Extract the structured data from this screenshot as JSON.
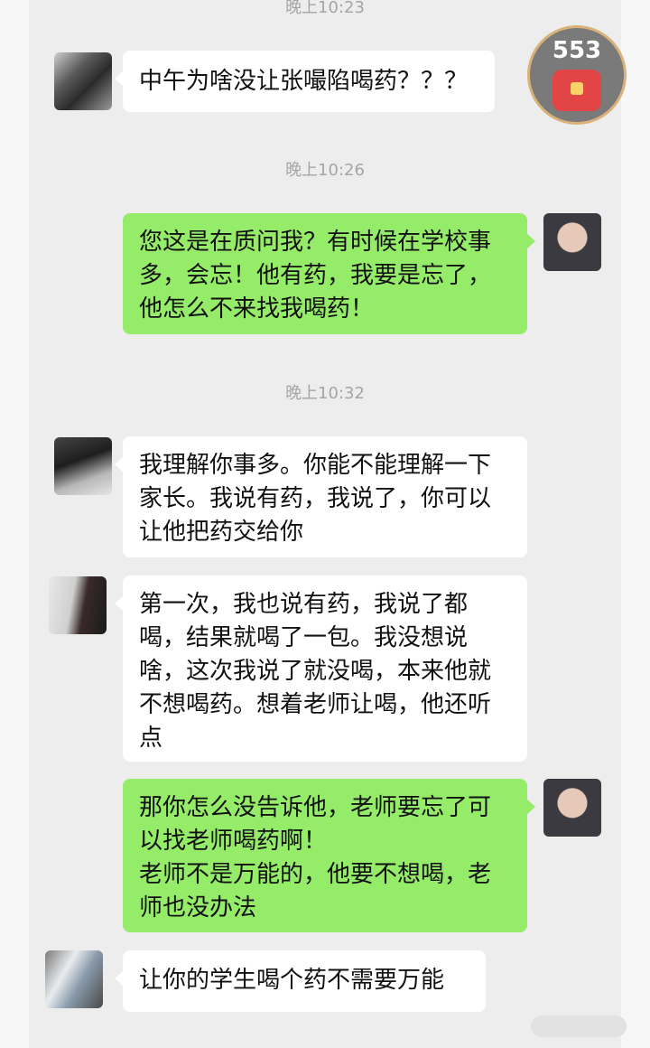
{
  "messages": {
    "m1": {
      "text": "中午为啥没让张嘬陷喝药？？？"
    },
    "m2": {
      "text": "您这是在质问我？有时候在学校事多，会忘！他有药，我要是忘了，他怎么不来找我喝药！"
    },
    "m3": {
      "text": "我理解你事多。你能不能理解一下家长。我说有药，我说了，你可以让他把药交给你"
    },
    "m4": {
      "text": "第一次，我也说有药，我说了都喝，结果就喝了一包。我没想说啥，这次我说了就没喝，本来他就不想喝药。想着老师让喝，他还听点"
    },
    "m5": {
      "text": "那你怎么没告诉他，老师要忘了可以找老师喝药啊！\n老师不是万能的，他要不想喝，老师也没办法"
    },
    "m6": {
      "text": "让你的学生喝个药不需要万能"
    }
  },
  "timestamps": {
    "t1": "晚上10:23",
    "t2": "晚上10:26",
    "t3": "晚上10:32"
  },
  "badge": {
    "count": "553",
    "icon": "red-envelope-icon"
  },
  "colors": {
    "incoming": "#ffffff",
    "outgoing": "#95ec69",
    "background": "#ededed"
  }
}
